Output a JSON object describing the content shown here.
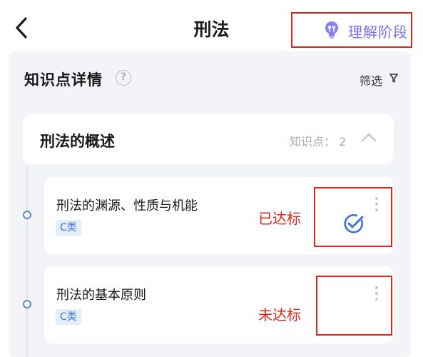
{
  "header": {
    "title": "刑法",
    "stage_label": "理解阶段"
  },
  "panel": {
    "title": "知识点详情",
    "help_glyph": "?",
    "filter_label": "筛选"
  },
  "chapter": {
    "title": "刑法的概述",
    "count_label": "知识点：",
    "count": "2"
  },
  "items": [
    {
      "title": "刑法的渊源、性质与机能",
      "tag": "C类",
      "status": "已达标",
      "achieved": true
    },
    {
      "title": "刑法的基本原则",
      "tag": "C类",
      "status": "未达标",
      "achieved": false
    }
  ],
  "colors": {
    "accent": "#7a6ff0",
    "annotation_red": "#e0241b",
    "tag_blue": "#3b74d6",
    "check_blue": "#3f73d0"
  },
  "icons": [
    "back-arrow-icon",
    "lightbulb-icon",
    "help-icon",
    "filter-icon",
    "chevron-up-icon",
    "more-vertical-icon",
    "check-circle-icon"
  ]
}
